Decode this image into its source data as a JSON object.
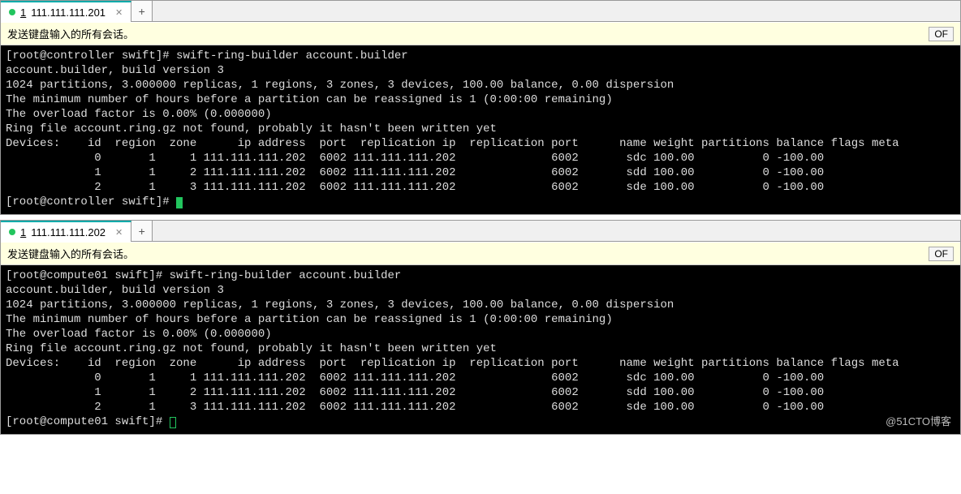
{
  "watermark": "@51CTO博客",
  "sessions": [
    {
      "tab_num": "1",
      "tab_ip": "111.111.111.201",
      "info_text": "发送键盘输入的所有会话。",
      "of_label": "OF",
      "prompt_start": "[root@controller swift]# ",
      "command": "swift-ring-builder account.builder",
      "lines": [
        "account.builder, build version 3",
        "1024 partitions, 3.000000 replicas, 1 regions, 3 zones, 3 devices, 100.00 balance, 0.00 dispersion",
        "The minimum number of hours before a partition can be reassigned is 1 (0:00:00 remaining)",
        "The overload factor is 0.00% (0.000000)",
        "Ring file account.ring.gz not found, probably it hasn't been written yet",
        "Devices:    id  region  zone      ip address  port  replication ip  replication port      name weight partitions balance flags meta",
        "             0       1     1 111.111.111.202  6002 111.111.111.202              6002       sdc 100.00          0 -100.00",
        "             1       1     2 111.111.111.202  6002 111.111.111.202              6002       sdd 100.00          0 -100.00",
        "             2       1     3 111.111.111.202  6002 111.111.111.202              6002       sde 100.00          0 -100.00"
      ],
      "prompt_end": "[root@controller swift]# ",
      "cursor_style": "block"
    },
    {
      "tab_num": "1",
      "tab_ip": "111.111.111.202",
      "info_text": "发送键盘输入的所有会话。",
      "of_label": "OF",
      "prompt_start": "[root@compute01 swift]# ",
      "command": "swift-ring-builder account.builder",
      "lines": [
        "account.builder, build version 3",
        "1024 partitions, 3.000000 replicas, 1 regions, 3 zones, 3 devices, 100.00 balance, 0.00 dispersion",
        "The minimum number of hours before a partition can be reassigned is 1 (0:00:00 remaining)",
        "The overload factor is 0.00% (0.000000)",
        "Ring file account.ring.gz not found, probably it hasn't been written yet",
        "Devices:    id  region  zone      ip address  port  replication ip  replication port      name weight partitions balance flags meta",
        "             0       1     1 111.111.111.202  6002 111.111.111.202              6002       sdc 100.00          0 -100.00",
        "             1       1     2 111.111.111.202  6002 111.111.111.202              6002       sdd 100.00          0 -100.00",
        "             2       1     3 111.111.111.202  6002 111.111.111.202              6002       sde 100.00          0 -100.00"
      ],
      "prompt_end": "[root@compute01 swift]# ",
      "cursor_style": "outline"
    }
  ]
}
